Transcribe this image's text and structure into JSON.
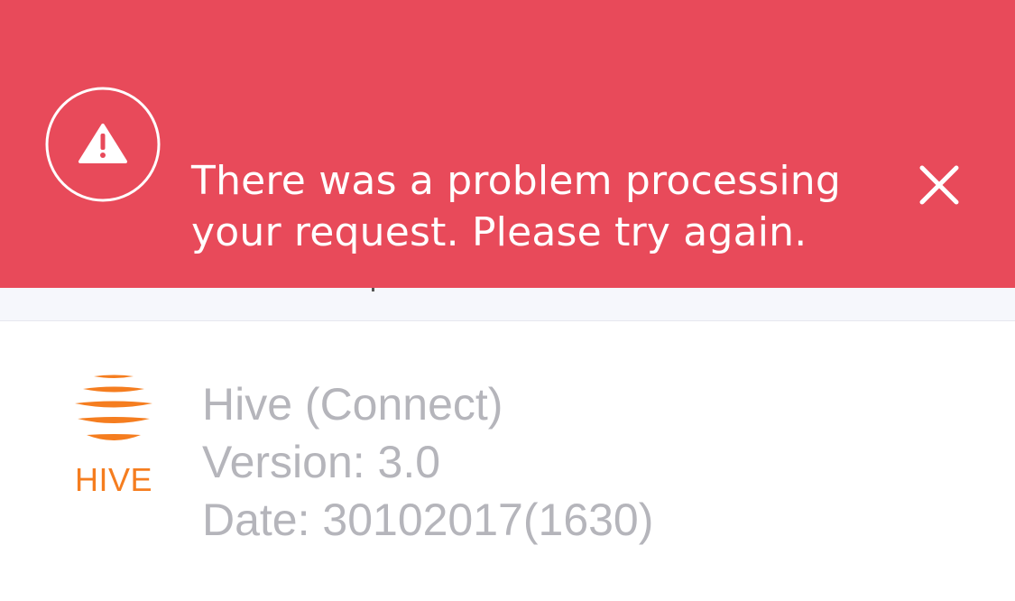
{
  "error_banner": {
    "message_line1": "There was a problem processing",
    "message_line2": "your request. Please try again.",
    "icon": "warning-icon",
    "close_icon": "close-icon",
    "background_color": "#e84a5a"
  },
  "about": {
    "logo_text": "HIVE",
    "logo_color": "#f57d1f",
    "app_name": "Hive (Connect)",
    "version": "Version: 3.0",
    "date": "Date: 30102017(1630)"
  }
}
